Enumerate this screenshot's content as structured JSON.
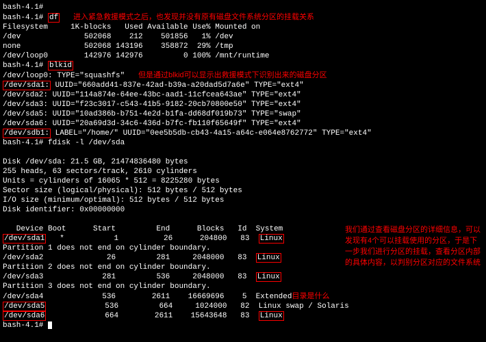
{
  "prompt1": "bash-4.1#",
  "prompt2": "bash-4.1#",
  "cmd_df": "df",
  "ann1": "进入紧急救援模式之后，也发现并没有原有磁盘文件系统分区的挂载关系",
  "df_header": "Filesystem     1K-blocks   Used Available Use% Mounted on",
  "df_rows": [
    "/dev              502068    212    501856   1% /dev",
    "none              502068 143196    358872  29% /tmp",
    "/dev/loop0        142976 142976         0 100% /mnt/runtime"
  ],
  "cmd_blkid": "blkid",
  "ann2": "但是通过blkid可以显示出救援模式下识别出来的磁盘分区",
  "blkid_loop": "/dev/loop0: TYPE=\"squashfs\"",
  "blkid_sda1": "/dev/sda1:",
  "blkid_sda1_rest": " UUID=\"660add41-837e-42ad-b39a-a20dad5d7a6e\" TYPE=\"ext4\"",
  "blkid_rows": [
    "/dev/sda2: UUID=\"114a874e-64ee-43bc-aad1-11cfcea643ae\" TYPE=\"ext4\"",
    "/dev/sda3: UUID=\"f23c3017-c543-41b5-9182-20cb70800e50\" TYPE=\"ext4\"",
    "/dev/sda5: UUID=\"10ad386b-b751-4e2d-b1fa-dd68df019b73\" TYPE=\"swap\"",
    "/dev/sda6: UUID=\"20a69d3d-34c6-436d-b7fc-fb110f65649f\" TYPE=\"ext4\""
  ],
  "blkid_sdb1": "/dev/sdb1:",
  "blkid_sdb1_rest": " LABEL=\"/home/\" UUID=\"0ee5b5db-cb43-4a15-a64c-e064e8762772\" TYPE=\"ext4\"",
  "cmd_fdisk": "bash-4.1# fdisk -l /dev/sda",
  "fdisk_info": [
    "Disk /dev/sda: 21.5 GB, 21474836480 bytes",
    "255 heads, 63 sectors/track, 2610 cylinders",
    "Units = cylinders of 16065 * 512 = 8225280 bytes",
    "Sector size (logical/physical): 512 bytes / 512 bytes",
    "I/O size (minimum/optimal): 512 bytes / 512 bytes",
    "Disk identifier: 0x00000000"
  ],
  "part_header": "   Device Boot      Start         End      Blocks   Id  System",
  "ann3": "我们通过查看磁盘分区的详细信息，可以发现有4个可以挂载使用的分区，于是下一步我们进行分区的挂载，查看分区内部的具体内容，以判别分区对应的文件系统",
  "ann4": "目录是什么",
  "p_sda1_dev": "/dev/sda1",
  "p_sda1_rest": "   *           1          26      204800   83  ",
  "p_sda1_sys": "Linux",
  "p_warn1": "Partition 1 does not end on cylinder boundary.",
  "p_sda2_dev": "/dev/sda2",
  "p_sda2_rest": "              26         281     2048000   83  ",
  "p_sda2_sys": "Linux",
  "p_warn2": "Partition 2 does not end on cylinder boundary.",
  "p_sda3_dev": "/dev/sda3",
  "p_sda3_rest": "             281         536     2048000   83  ",
  "p_sda3_sys": "Linux",
  "p_warn3": "Partition 3 does not end on cylinder boundary.",
  "p_sda4": "/dev/sda4             536        2611    16669696    5  Extended",
  "p_sda5_dev": "/dev/sda5",
  "p_sda5_rest": "             536         664     1024000   82  Linux swap / Solaris",
  "p_sda6_dev": "/dev/sda6",
  "p_sda6_rest": "             664        2611    15643648   83  ",
  "p_sda6_sys": "Linux",
  "prompt_end": "bash-4.1# "
}
